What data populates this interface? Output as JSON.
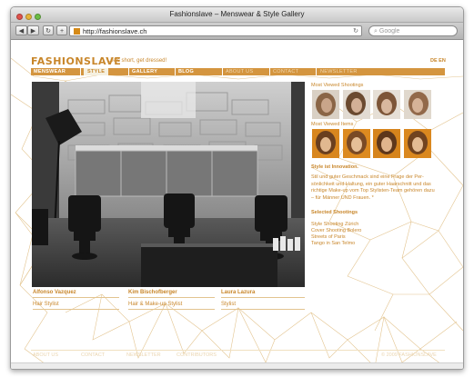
{
  "browser": {
    "title": "Fashionslave – Menswear & Style Gallery",
    "url": "http://fashionslave.ch",
    "search_placeholder": "Google",
    "back_icon": "back-arrow-icon",
    "forward_icon": "forward-arrow-icon"
  },
  "header": {
    "logo": "FASHIONSLAVE",
    "slogan": "Life's short, get dressed!",
    "lang": "DE EN"
  },
  "nav": {
    "items": [
      {
        "label": "MENSWEAR"
      },
      {
        "label": "STYLE"
      },
      {
        "label": "GALLERY"
      },
      {
        "label": "BLOG"
      },
      {
        "label": "ABOUT US"
      },
      {
        "label": "CONTACT"
      },
      {
        "label": "NEWSLETTER"
      }
    ]
  },
  "team": [
    {
      "name": "Alfonso Vazquez",
      "role": "Hair Stylist"
    },
    {
      "name": "Kim Bischofberger",
      "role": "Hair & Make-up Stylist"
    },
    {
      "name": "Laura Lazura",
      "role": "Stylist"
    }
  ],
  "sidebar": {
    "most_viewed_shootings": "Most Viewed Shootings",
    "most_viewed_items": "Most Viewed Items",
    "style_heading": "Style ist Innovation.",
    "style_text": "Stil und guter Geschmack sind eine Frage der Per-sönlichkeit und Haltung, ein guter Haarschnitt und das richtige Make-up vom Top Stylisten-Team gehören dazu – für Männer UND Frauen. *",
    "selected_heading": "Selected Shootings",
    "selected_links": [
      "Style Shooting Zürich",
      "Cover Shooting Bolero",
      "Streets of Paris",
      "Tango in San Telmo"
    ]
  },
  "footer": {
    "links": [
      "ABOUT US",
      "CONTACT",
      "NEWSLETTER",
      "CONTRIBUTORS"
    ],
    "copyright": "© 2009 FASHIONSLAVE"
  },
  "colors": {
    "accent": "#c8862a",
    "nav": "#d4953f",
    "lines": "#e3c48f"
  }
}
